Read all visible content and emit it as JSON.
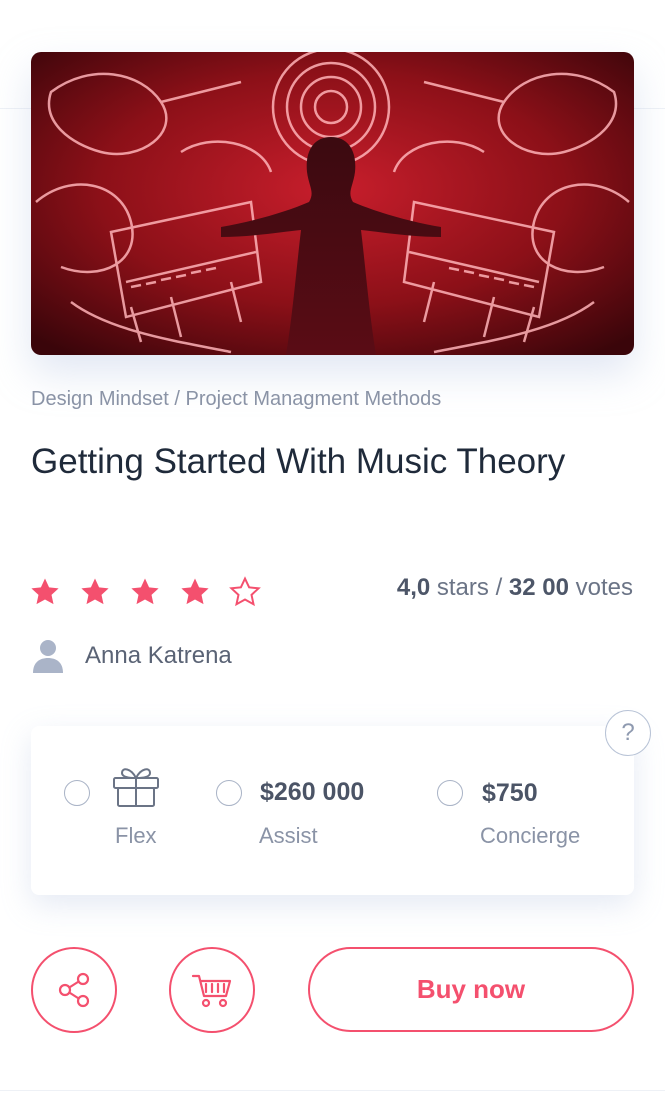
{
  "product": {
    "breadcrumb": "Design Mindset / Project Managment Methods",
    "title": "Getting Started With Music Theory",
    "rating": {
      "value": 4,
      "max": 5,
      "score_text": "4,0",
      "stars_word": " stars / ",
      "votes_text": "32 00",
      "votes_word": " votes"
    },
    "author": "Anna Katrena"
  },
  "plans": [
    {
      "price": "",
      "icon": "gift-icon",
      "label": "Flex"
    },
    {
      "price": "$260 000",
      "label": "Assist"
    },
    {
      "price": "$750",
      "label": "Concierge"
    }
  ],
  "help_label": "?",
  "actions": {
    "share_icon": "share-icon",
    "cart_icon": "cart-icon",
    "buy_label": "Buy now"
  },
  "colors": {
    "accent": "#f4506e",
    "title": "#1f2a3a",
    "muted": "#8a93a6"
  }
}
